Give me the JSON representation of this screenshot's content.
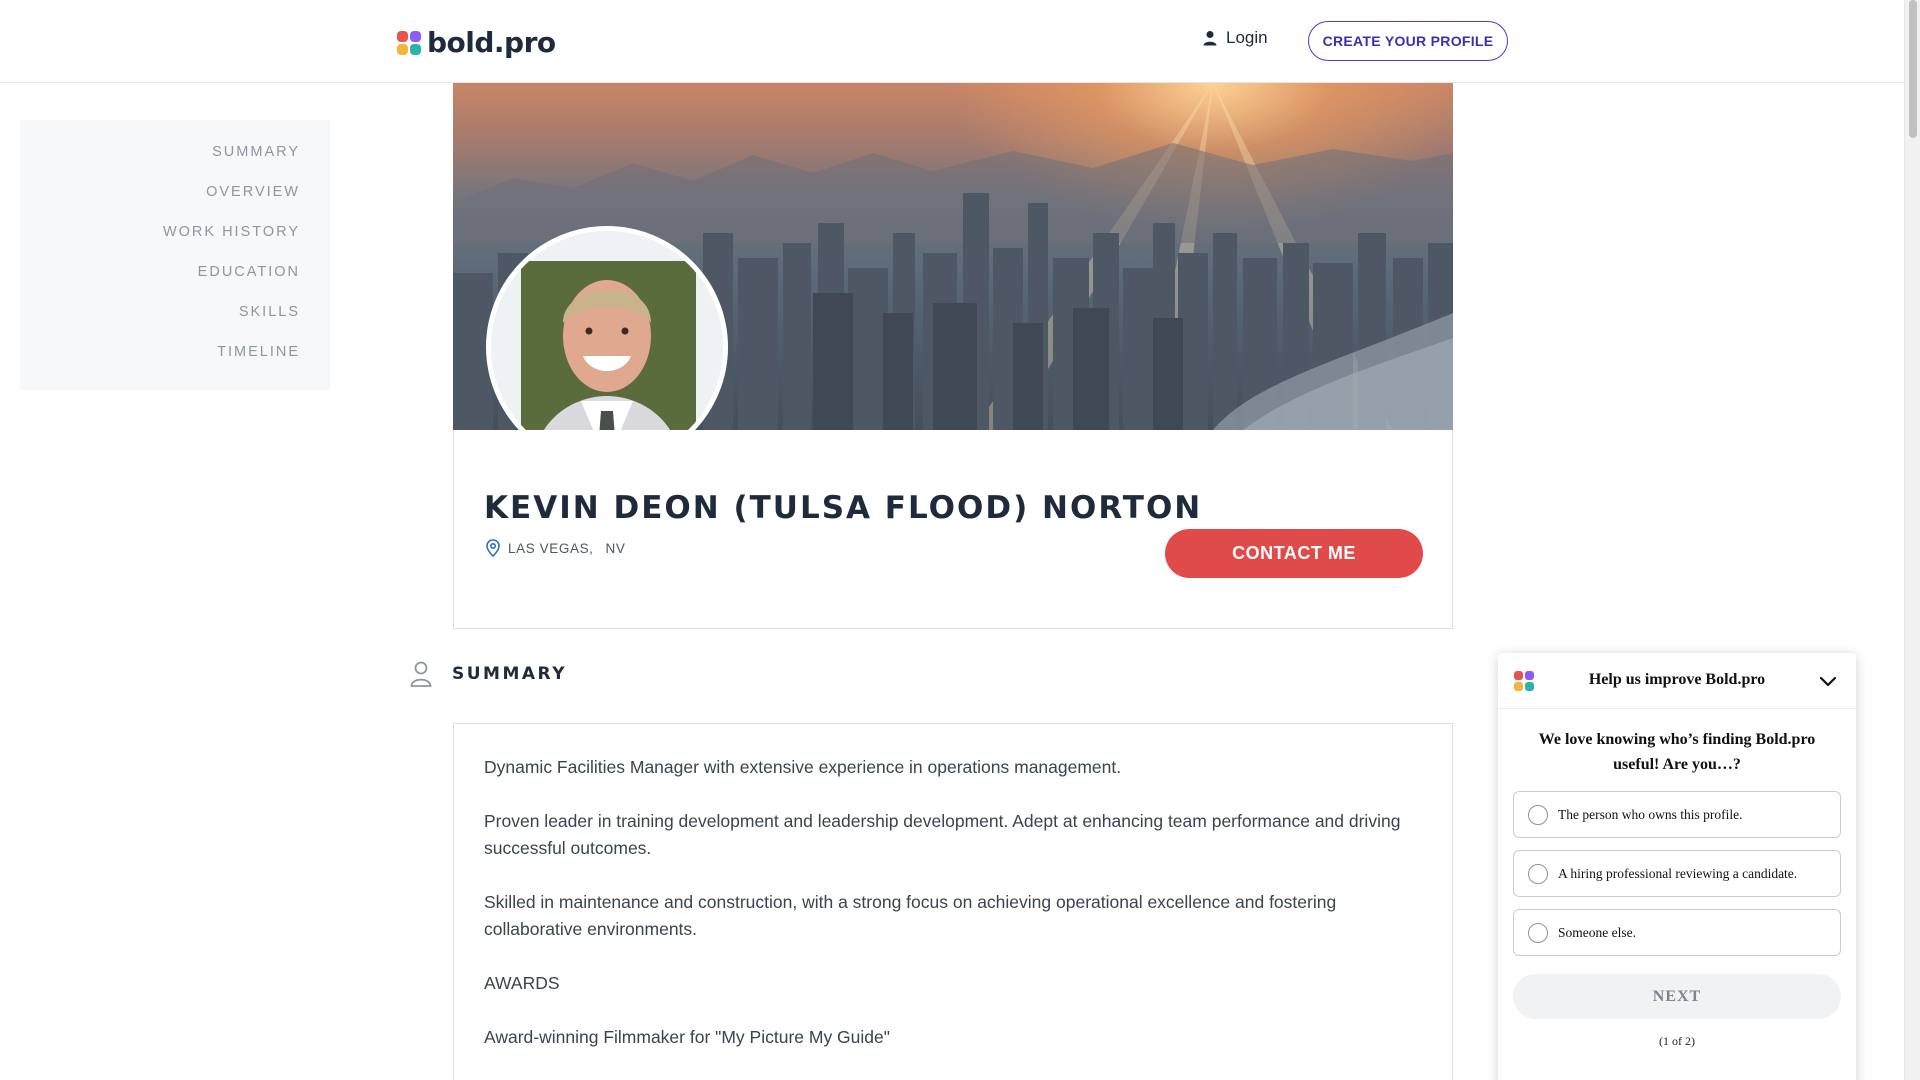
{
  "header": {
    "logo_text": "bold.pro",
    "login_label": "Login",
    "create_profile_label": "CREATE YOUR PROFILE"
  },
  "sidenav": {
    "items": [
      "SUMMARY",
      "OVERVIEW",
      "WORK HISTORY",
      "EDUCATION",
      "SKILLS",
      "TIMELINE"
    ]
  },
  "profile": {
    "name": "KEVIN DEON (TULSA FLOOD) NORTON",
    "city": "LAS VEGAS,",
    "state": "NV",
    "contact_label": "CONTACT ME"
  },
  "summary": {
    "title": "SUMMARY",
    "paragraphs": [
      "Dynamic Facilities Manager with extensive experience in operations management.",
      "Proven leader in training development and leadership development. Adept at enhancing team performance and driving successful outcomes.",
      "Skilled in maintenance and construction, with a strong focus on achieving operational excellence and fostering collaborative environments.",
      "AWARDS",
      "Award-winning Filmmaker for \"My Picture My Guide\""
    ]
  },
  "feedback_widget": {
    "title": "Help us improve Bold.pro",
    "question": "We love knowing who’s finding Bold.pro useful! Are you…?",
    "options": [
      "The person who owns this profile.",
      "A hiring professional reviewing a candidate.",
      "Someone else."
    ],
    "next_label": "NEXT",
    "pager": "(1 of 2)"
  },
  "colors": {
    "brand_purple": "#4a3fbf",
    "contact_red": "#e04a4a",
    "logo_red": "#e8534f",
    "logo_purple": "#8b5cf6",
    "logo_yellow": "#f2b43b",
    "logo_teal": "#2bb5a8"
  },
  "icons": {
    "login": "user-icon",
    "location": "map-pin-icon",
    "summary": "person-outline-icon",
    "widget_toggle": "chevron-down-icon"
  }
}
